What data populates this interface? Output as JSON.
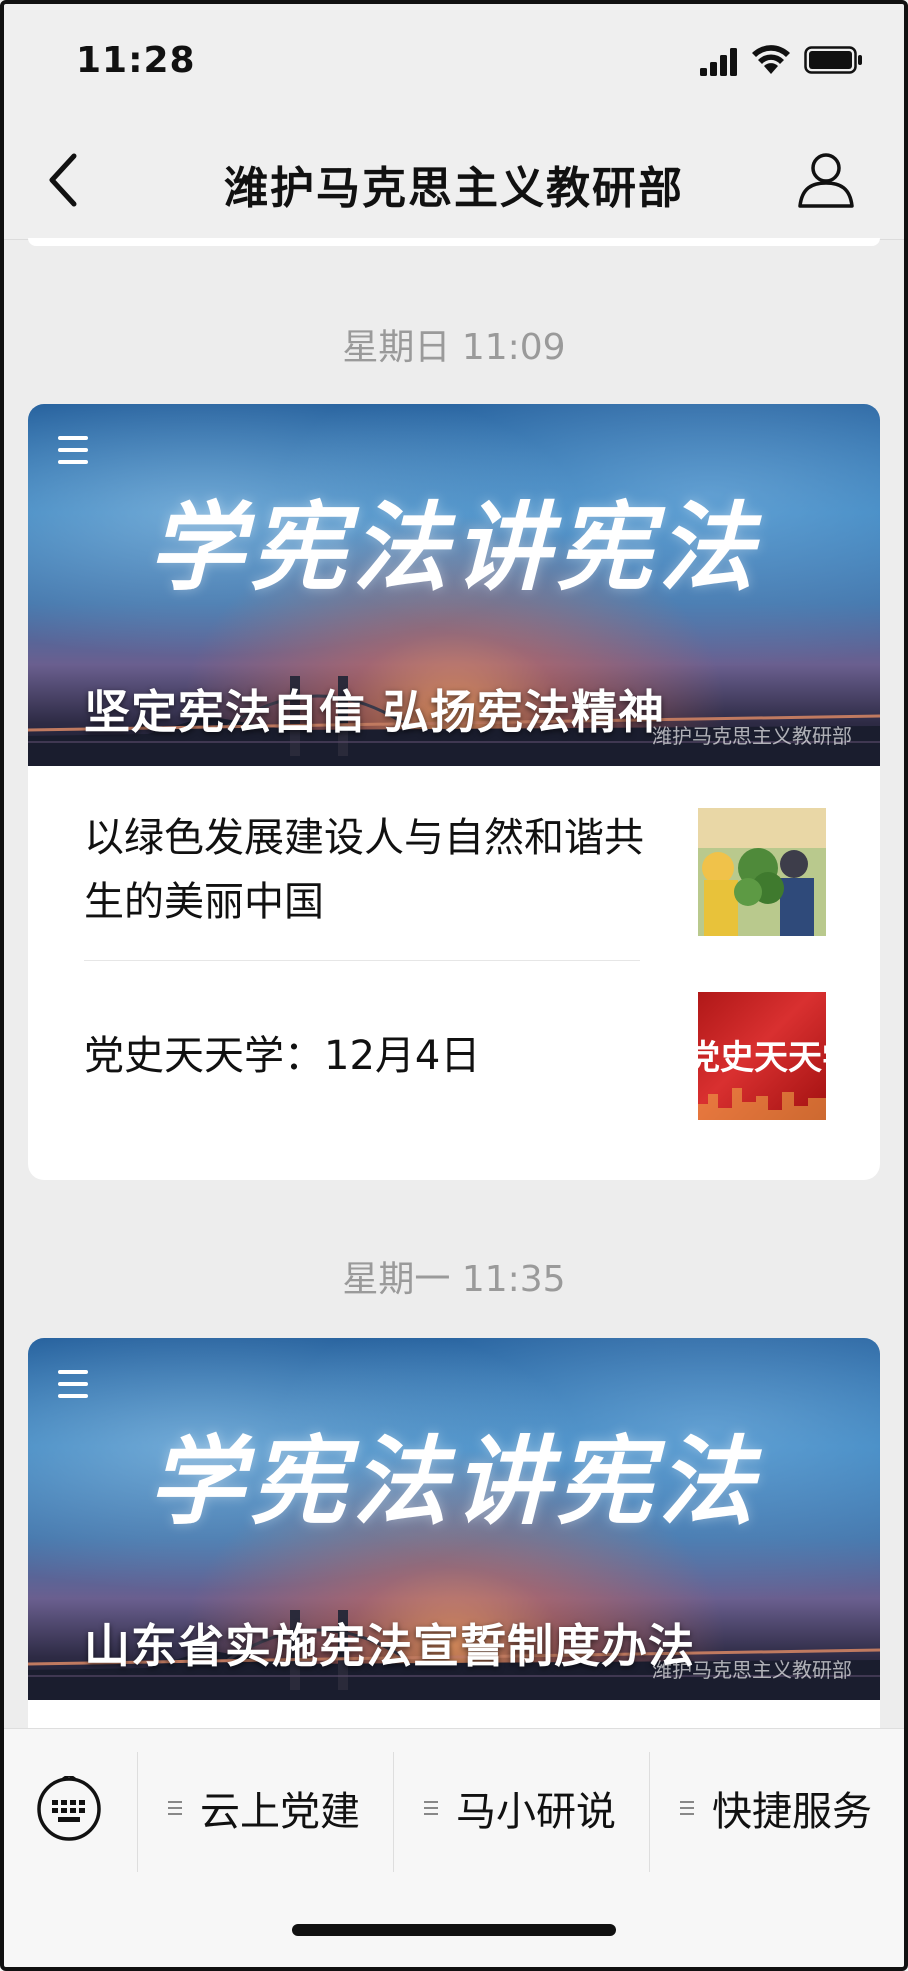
{
  "status_bar": {
    "time": "11:28"
  },
  "nav": {
    "title": "潍护马克思主义教研部",
    "back_icon": "chevron-left-icon",
    "profile_icon": "person-icon"
  },
  "feed": [
    {
      "timestamp": "星期日 11:09",
      "banner": {
        "calligraphy": "学宪法讲宪法",
        "headline": "坚定宪法自信 弘扬宪法精神",
        "watermark": "潍护马克思主义教研部"
      },
      "articles": [
        {
          "title": "以绿色发展建设人与自然和谐共生的美丽中国",
          "thumb": "green-plant-photo"
        },
        {
          "title": "党史天天学：12月4日",
          "thumb": "red-banner-image",
          "thumb_text": "党史天天学"
        }
      ]
    },
    {
      "timestamp": "星期一 11:35",
      "banner": {
        "calligraphy": "学宪法讲宪法",
        "headline": "山东省实施宪法宣誓制度办法",
        "watermark": "潍护马克思主义教研部"
      }
    }
  ],
  "bottom_menu": {
    "keyboard_icon": "keyboard-icon",
    "tabs": [
      {
        "label": "云上党建"
      },
      {
        "label": "马小研说"
      },
      {
        "label": "快捷服务"
      }
    ]
  }
}
